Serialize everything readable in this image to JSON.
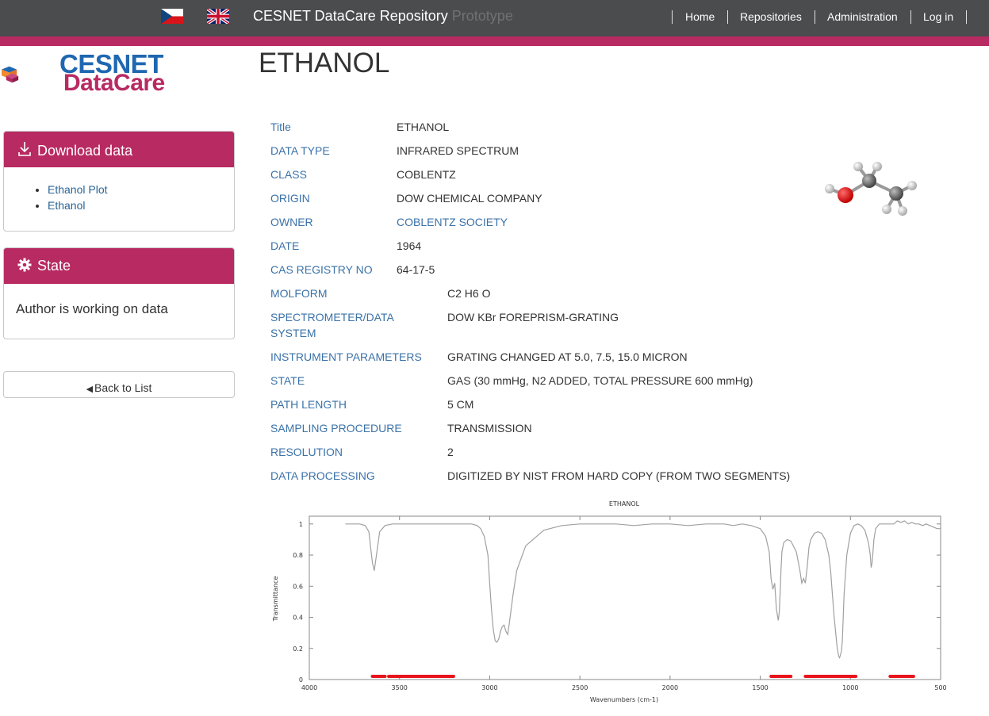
{
  "navbar": {
    "brand": "CESNET DataCare Repository",
    "brand_suffix": "Prototype",
    "links": [
      "Home",
      "Repositories",
      "Administration",
      "Log in"
    ],
    "flags": [
      "czech-flag-icon",
      "uk-flag-icon"
    ]
  },
  "logo": {
    "line1": "CESNET",
    "line2": "DataCare"
  },
  "page": {
    "title": "ETHANOL"
  },
  "sidebar": {
    "download": {
      "title": "Download data",
      "icon": "download-icon",
      "items": [
        "Ethanol Plot",
        "Ethanol"
      ]
    },
    "state": {
      "title": "State",
      "icon": "gear-icon",
      "text": "Author is working on data"
    },
    "back_label": "Back to List"
  },
  "metadata": [
    {
      "key": "Title",
      "value": "ETHANOL"
    },
    {
      "key": "DATA TYPE",
      "value": "INFRARED SPECTRUM"
    },
    {
      "key": "CLASS",
      "value": "COBLENTZ"
    },
    {
      "key": "ORIGIN",
      "value": "DOW CHEMICAL COMPANY"
    },
    {
      "key": "OWNER",
      "value": "COBLENTZ SOCIETY"
    },
    {
      "key": "DATE",
      "value": "1964"
    },
    {
      "key": "CAS REGISTRY NO",
      "value": "64-17-5"
    },
    {
      "key": "MOLFORM",
      "value": "C2 H6 O"
    },
    {
      "key": "SPECTROMETER/DATA",
      "key2": "SYSTEM",
      "value": "DOW KBr FOREPRISM-GRATING"
    },
    {
      "key": "INSTRUMENT PARAMETERS",
      "value": "GRATING CHANGED AT 5.0, 7.5, 15.0 MICRON"
    },
    {
      "key": "STATE",
      "value": "GAS (30 mmHg, N2 ADDED, TOTAL PRESSURE 600 mmHg)"
    },
    {
      "key": "PATH LENGTH",
      "value": "5 CM"
    },
    {
      "key": "SAMPLING PROCEDURE",
      "value": "TRANSMISSION"
    },
    {
      "key": "RESOLUTION",
      "value": "2"
    },
    {
      "key": "DATA PROCESSING",
      "value": "DIGITIZED BY NIST FROM HARD COPY (FROM TWO SEGMENTS)"
    }
  ],
  "colors": {
    "navbar": "#4a4c4e",
    "accent": "#b82a62",
    "link": "#3b72a8",
    "logo_blue": "#1f67b1",
    "spectrum_line": "#a0a0a0",
    "marker": "#e8141c"
  },
  "chart_data": {
    "type": "line",
    "title": "ETHANOL",
    "xlabel": "Wavenumbers (cm-1)",
    "ylabel": "Transmittance",
    "xlim": [
      4000,
      500
    ],
    "ylim": [
      0,
      1.05
    ],
    "xticks": [
      4000,
      3500,
      3000,
      2500,
      2000,
      1500,
      1000,
      500
    ],
    "yticks": [
      0,
      0.2,
      0.4,
      0.6,
      0.8,
      1
    ],
    "grid": false,
    "series": [
      {
        "x": [
          3800,
          3720,
          3690,
          3670,
          3660,
          3650,
          3640,
          3630,
          3610,
          3580,
          3540,
          3500,
          3400,
          3300,
          3200,
          3100,
          3070,
          3050,
          3030,
          3010,
          3000,
          2990,
          2980,
          2970,
          2960,
          2950,
          2940,
          2930,
          2920,
          2910,
          2900,
          2890,
          2870,
          2850,
          2800,
          2700,
          2600,
          2500,
          2400,
          2300,
          2200,
          2100,
          2000,
          1900,
          1800,
          1700,
          1650,
          1600,
          1550,
          1500,
          1470,
          1450,
          1440,
          1430,
          1420,
          1410,
          1400,
          1395,
          1390,
          1385,
          1380,
          1370,
          1350,
          1330,
          1300,
          1280,
          1270,
          1260,
          1250,
          1240,
          1230,
          1220,
          1200,
          1180,
          1160,
          1140,
          1120,
          1110,
          1100,
          1090,
          1080,
          1075,
          1070,
          1065,
          1060,
          1055,
          1050,
          1045,
          1040,
          1035,
          1020,
          1000,
          980,
          960,
          940,
          920,
          900,
          890,
          885,
          880,
          875,
          870,
          860,
          840,
          820,
          800,
          780,
          760,
          740,
          720,
          700,
          680,
          660,
          640,
          620,
          600,
          580,
          560,
          540,
          520,
          500
        ],
        "y": [
          1.0,
          1.0,
          0.99,
          0.95,
          0.85,
          0.75,
          0.7,
          0.78,
          0.95,
          0.99,
          1.0,
          1.0,
          1.0,
          1.0,
          1.0,
          1.0,
          0.99,
          0.97,
          0.92,
          0.8,
          0.62,
          0.45,
          0.32,
          0.25,
          0.24,
          0.26,
          0.31,
          0.34,
          0.35,
          0.31,
          0.29,
          0.37,
          0.55,
          0.7,
          0.86,
          0.96,
          0.99,
          1.0,
          1.0,
          1.0,
          0.99,
          1.0,
          1.0,
          0.99,
          1.0,
          1.0,
          0.99,
          1.0,
          0.99,
          0.97,
          0.92,
          0.82,
          0.65,
          0.58,
          0.62,
          0.45,
          0.38,
          0.43,
          0.55,
          0.7,
          0.82,
          0.88,
          0.9,
          0.89,
          0.82,
          0.7,
          0.62,
          0.65,
          0.62,
          0.72,
          0.85,
          0.9,
          0.94,
          0.95,
          0.94,
          0.9,
          0.8,
          0.7,
          0.55,
          0.4,
          0.28,
          0.22,
          0.18,
          0.15,
          0.14,
          0.16,
          0.18,
          0.25,
          0.4,
          0.55,
          0.8,
          0.94,
          0.99,
          1.0,
          0.99,
          0.96,
          0.88,
          0.8,
          0.72,
          0.75,
          0.82,
          0.9,
          0.97,
          1.0,
          1.0,
          1.0,
          1.0,
          1.0,
          1.02,
          1.01,
          1.02,
          1.0,
          1.01,
          1.0,
          1.0,
          0.99,
          1.0,
          0.99,
          0.98,
          0.97,
          0.97
        ]
      }
    ],
    "markers": [
      {
        "from": 3650,
        "to": 3580
      },
      {
        "from": 3560,
        "to": 3200
      },
      {
        "from": 1440,
        "to": 1330
      },
      {
        "from": 1250,
        "to": 970
      },
      {
        "from": 780,
        "to": 650
      }
    ]
  }
}
